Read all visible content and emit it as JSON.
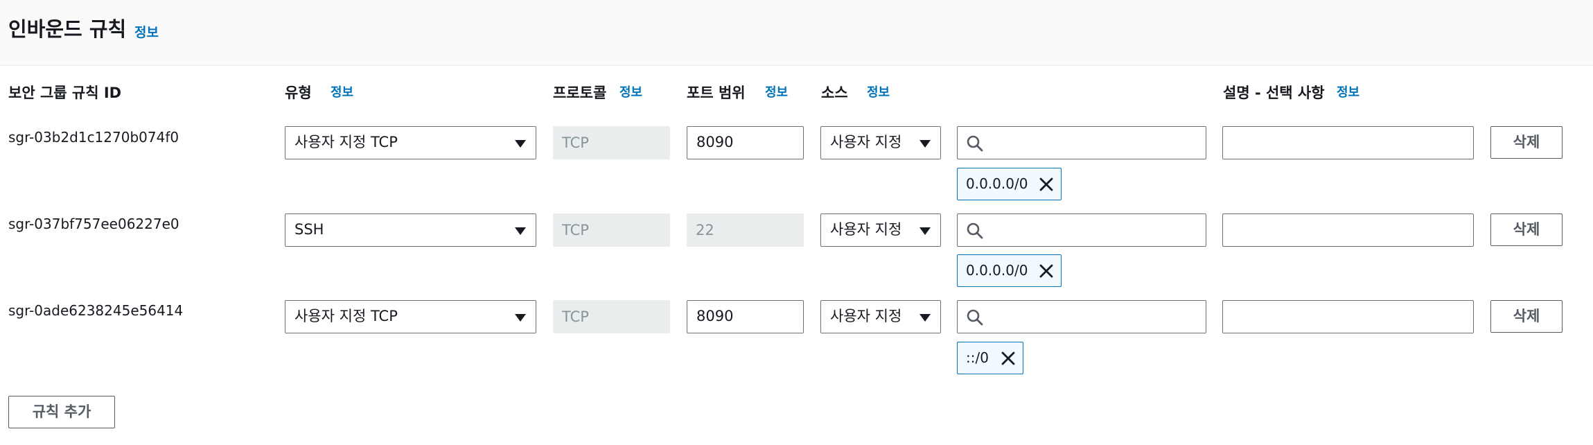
{
  "section": {
    "title": "인바운드 규칙",
    "info": "정보"
  },
  "columns": {
    "rule_id": "보안 그룹 규칙 ID",
    "type": "유형",
    "type_info": "정보",
    "protocol": "프로토콜",
    "protocol_info": "정보",
    "port_range": "포트 범위",
    "port_range_info": "정보",
    "source": "소스",
    "source_info": "정보",
    "description": "설명 - 선택 사항",
    "description_info": "정보"
  },
  "rules": [
    {
      "id": "sgr-03b2d1c1270b074f0",
      "type": "사용자 지정 TCP",
      "protocol": "TCP",
      "port": "8090",
      "source_type": "사용자 지정",
      "search_value": "",
      "cidr": "0.0.0.0/0",
      "description": "",
      "delete_label": "삭제"
    },
    {
      "id": "sgr-037bf757ee06227e0",
      "type": "SSH",
      "protocol": "TCP",
      "port": "22",
      "source_type": "사용자 지정",
      "search_value": "",
      "cidr": "0.0.0.0/0",
      "description": "",
      "delete_label": "삭제"
    },
    {
      "id": "sgr-0ade6238245e56414",
      "type": "사용자 지정 TCP",
      "protocol": "TCP",
      "port": "8090",
      "source_type": "사용자 지정",
      "search_value": "",
      "cidr": "::/0",
      "description": "",
      "delete_label": "삭제"
    }
  ],
  "add_rule_label": "규칙 추가",
  "colors": {
    "link": "#0073bb",
    "tag_border": "#0073bb",
    "tag_bg": "#f1faff",
    "disabled_bg": "#eaeded"
  },
  "icons": {
    "search": "search-icon",
    "dismiss": "close-icon",
    "dropdown": "caret-down-icon"
  }
}
